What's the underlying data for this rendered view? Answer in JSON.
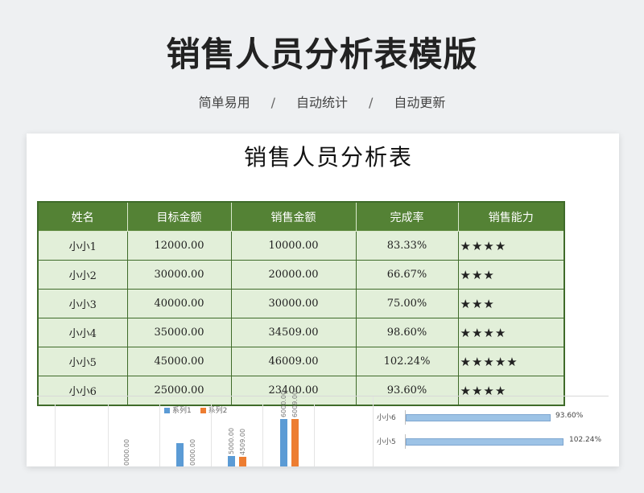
{
  "header": {
    "title": "销售人员分析表模版",
    "subtitle_parts": [
      "简单易用",
      "自动统计",
      "自动更新"
    ],
    "separator": "/"
  },
  "sheet": {
    "title": "销售人员分析表",
    "columns": [
      "姓名",
      "目标金额",
      "销售金额",
      "完成率",
      "销售能力"
    ],
    "rows": [
      {
        "name": "小小1",
        "target": "12000.00",
        "sales": "10000.00",
        "rate": "83.33%",
        "ability": "★★★★"
      },
      {
        "name": "小小2",
        "target": "30000.00",
        "sales": "20000.00",
        "rate": "66.67%",
        "ability": "★★★"
      },
      {
        "name": "小小3",
        "target": "40000.00",
        "sales": "30000.00",
        "rate": "75.00%",
        "ability": "★★★"
      },
      {
        "name": "小小4",
        "target": "35000.00",
        "sales": "34509.00",
        "rate": "98.60%",
        "ability": "★★★★"
      },
      {
        "name": "小小5",
        "target": "45000.00",
        "sales": "46009.00",
        "rate": "102.24%",
        "ability": "★★★★★"
      },
      {
        "name": "小小6",
        "target": "25000.00",
        "sales": "23400.00",
        "rate": "93.60%",
        "ability": "★★★★"
      }
    ],
    "colors": {
      "header_bg": "#548235",
      "cell_bg": "#e2efd9",
      "border": "#3f6b2a"
    }
  },
  "chart_data": [
    {
      "type": "bar",
      "legend": [
        "系列1",
        "系列2"
      ],
      "legend_colors": [
        "#5b9bd5",
        "#ed7d31"
      ],
      "visible_values": [
        "0000.00",
        "0000.00",
        "5000.00",
        "4509.00",
        "6000.00",
        "6009.00"
      ]
    },
    {
      "type": "bar",
      "orientation": "horizontal",
      "categories": [
        "小小6",
        "小小5"
      ],
      "values": [
        93.6,
        102.24
      ],
      "labels": [
        "93.60%",
        "102.24%"
      ],
      "color": "#9dc3e6"
    }
  ]
}
